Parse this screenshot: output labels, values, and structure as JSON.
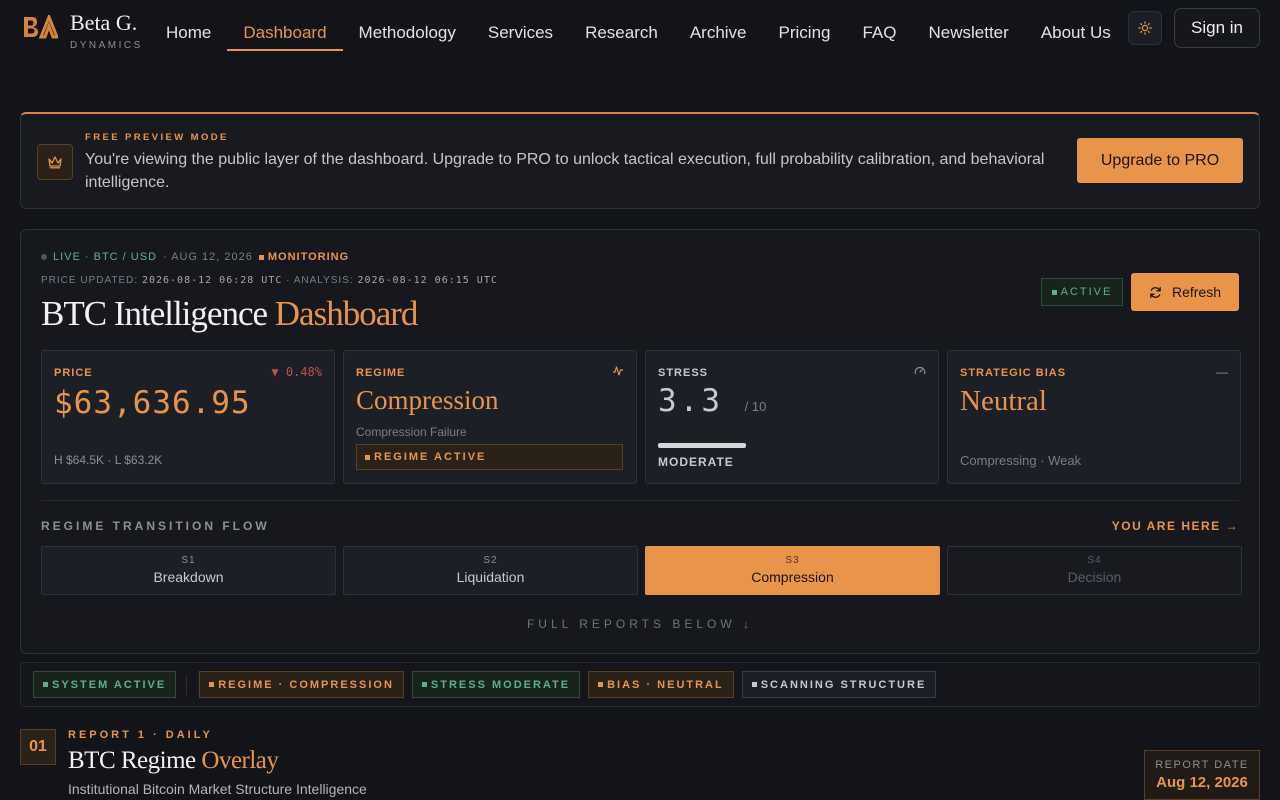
{
  "brand": {
    "name": "Beta G.",
    "sub": "DYNAMICS"
  },
  "nav": {
    "links": [
      "Home",
      "Dashboard",
      "Methodology",
      "Services",
      "Research",
      "Archive",
      "Pricing",
      "FAQ",
      "Newsletter",
      "About Us"
    ],
    "active": "Dashboard",
    "signin": "Sign in"
  },
  "banner": {
    "kicker": "FREE PREVIEW MODE",
    "message": "You're viewing the public layer of the dashboard. Upgrade to PRO to unlock tactical execution, full probability calibration, and behavioral intelligence.",
    "cta": "Upgrade to PRO"
  },
  "panel": {
    "live": "LIVE · BTC / USD",
    "date": "· AUG 12, 2026",
    "monitoring": "MONITORING",
    "price_updated_label": "PRICE UPDATED:",
    "price_updated": "2026-08-12 06:28 UTC",
    "analysis_label": "· ANALYSIS:",
    "analysis": "2026-08-12 06:15 UTC",
    "title_main": "BTC Intelligence",
    "title_accent": "Dashboard",
    "active_badge": "ACTIVE",
    "refresh": "Refresh"
  },
  "cards": {
    "price": {
      "label": "PRICE",
      "change": "▼ 0.48%",
      "value": "$63,636.95",
      "range": "H $64.5K · L $63.2K"
    },
    "regime": {
      "label": "REGIME",
      "value": "Compression",
      "sub": "Compression Failure",
      "chip": "REGIME ACTIVE"
    },
    "stress": {
      "label": "STRESS",
      "value": "3.3",
      "denominator": "/ 10",
      "level": "MODERATE",
      "fill_fraction": 0.33
    },
    "bias": {
      "label": "STRATEGIC BIAS",
      "corner": "—",
      "value": "Neutral",
      "sub": "Compressing · Weak"
    }
  },
  "flow": {
    "title": "REGIME TRANSITION FLOW",
    "here": "YOU ARE HERE →",
    "stages": [
      {
        "code": "S1",
        "name": "Breakdown"
      },
      {
        "code": "S2",
        "name": "Liquidation"
      },
      {
        "code": "S3",
        "name": "Compression"
      },
      {
        "code": "S4",
        "name": "Decision"
      }
    ],
    "full_reports": "FULL REPORTS BELOW ↓"
  },
  "status_tags": [
    "SYSTEM ACTIVE",
    "REGIME · COMPRESSION",
    "STRESS MODERATE",
    "BIAS · NEUTRAL",
    "SCANNING STRUCTURE"
  ],
  "report": {
    "number": "01",
    "kicker": "REPORT 1 · DAILY",
    "title_main": "BTC Regime",
    "title_accent": "Overlay",
    "subtitle": "Institutional Bitcoin Market Structure Intelligence",
    "date_label": "REPORT DATE",
    "date_value": "Aug 12, 2026"
  },
  "colors": {
    "accent": "#e8954a",
    "green": "#5fb08a",
    "background": "#121419"
  }
}
